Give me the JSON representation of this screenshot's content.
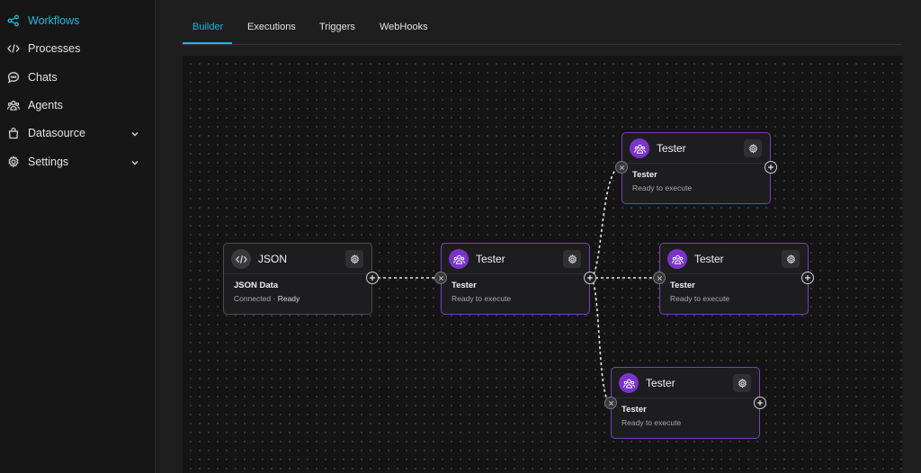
{
  "sidebar": {
    "items": [
      {
        "label": "Workflows",
        "icon": "share-nodes-icon",
        "active": true
      },
      {
        "label": "Processes",
        "icon": "code-icon"
      },
      {
        "label": "Chats",
        "icon": "chat-bubble-icon"
      },
      {
        "label": "Agents",
        "icon": "users-icon"
      },
      {
        "label": "Datasource",
        "icon": "bag-icon",
        "expandable": true
      },
      {
        "label": "Settings",
        "icon": "gear-icon",
        "expandable": true
      }
    ]
  },
  "tabs": [
    {
      "label": "Builder",
      "active": true
    },
    {
      "label": "Executions"
    },
    {
      "label": "Triggers"
    },
    {
      "label": "WebHooks"
    }
  ],
  "nodes": [
    {
      "id": "json",
      "title": "JSON",
      "subtitle": "JSON Data",
      "status_prefix": "Connected",
      "status_sep": "·",
      "status": "Ready"
    },
    {
      "id": "tester-1",
      "title": "Tester",
      "subtitle": "Tester",
      "status": "Ready to execute"
    },
    {
      "id": "tester-2",
      "title": "Tester",
      "subtitle": "Tester",
      "status": "Ready to execute"
    },
    {
      "id": "tester-3",
      "title": "Tester",
      "subtitle": "Tester",
      "status": "Ready to execute"
    },
    {
      "id": "tester-4",
      "title": "Tester",
      "subtitle": "Tester",
      "status": "Ready to execute"
    }
  ],
  "colors": {
    "accent": "#1fb6d7",
    "agent_purple": "#7b34c9",
    "node_border": "#7a3fc0"
  }
}
